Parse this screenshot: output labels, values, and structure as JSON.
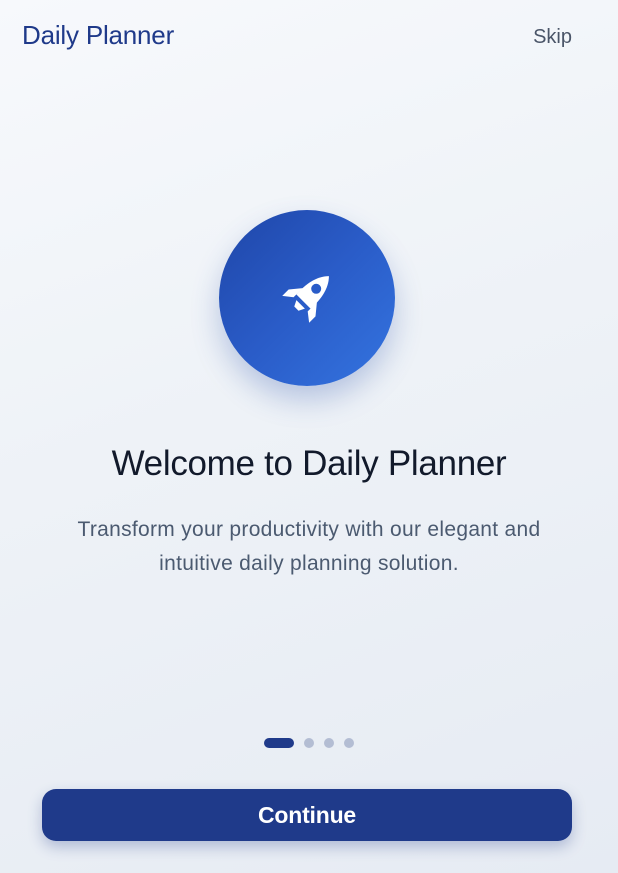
{
  "header": {
    "app_title": "Daily Planner",
    "skip_label": "Skip"
  },
  "hero": {
    "icon": "rocket-icon"
  },
  "welcome": {
    "title": "Welcome to Daily Planner",
    "description": "Transform your productivity with our elegant and intuitive daily planning solution."
  },
  "pager": {
    "total_pages": 4,
    "current_page": 1
  },
  "footer": {
    "continue_label": "Continue"
  },
  "colors": {
    "brand": "#1f3a8a",
    "accent_gradient_start": "#1f46a8",
    "accent_gradient_end": "#3474e0",
    "inactive_dot": "#b3bdd3"
  }
}
